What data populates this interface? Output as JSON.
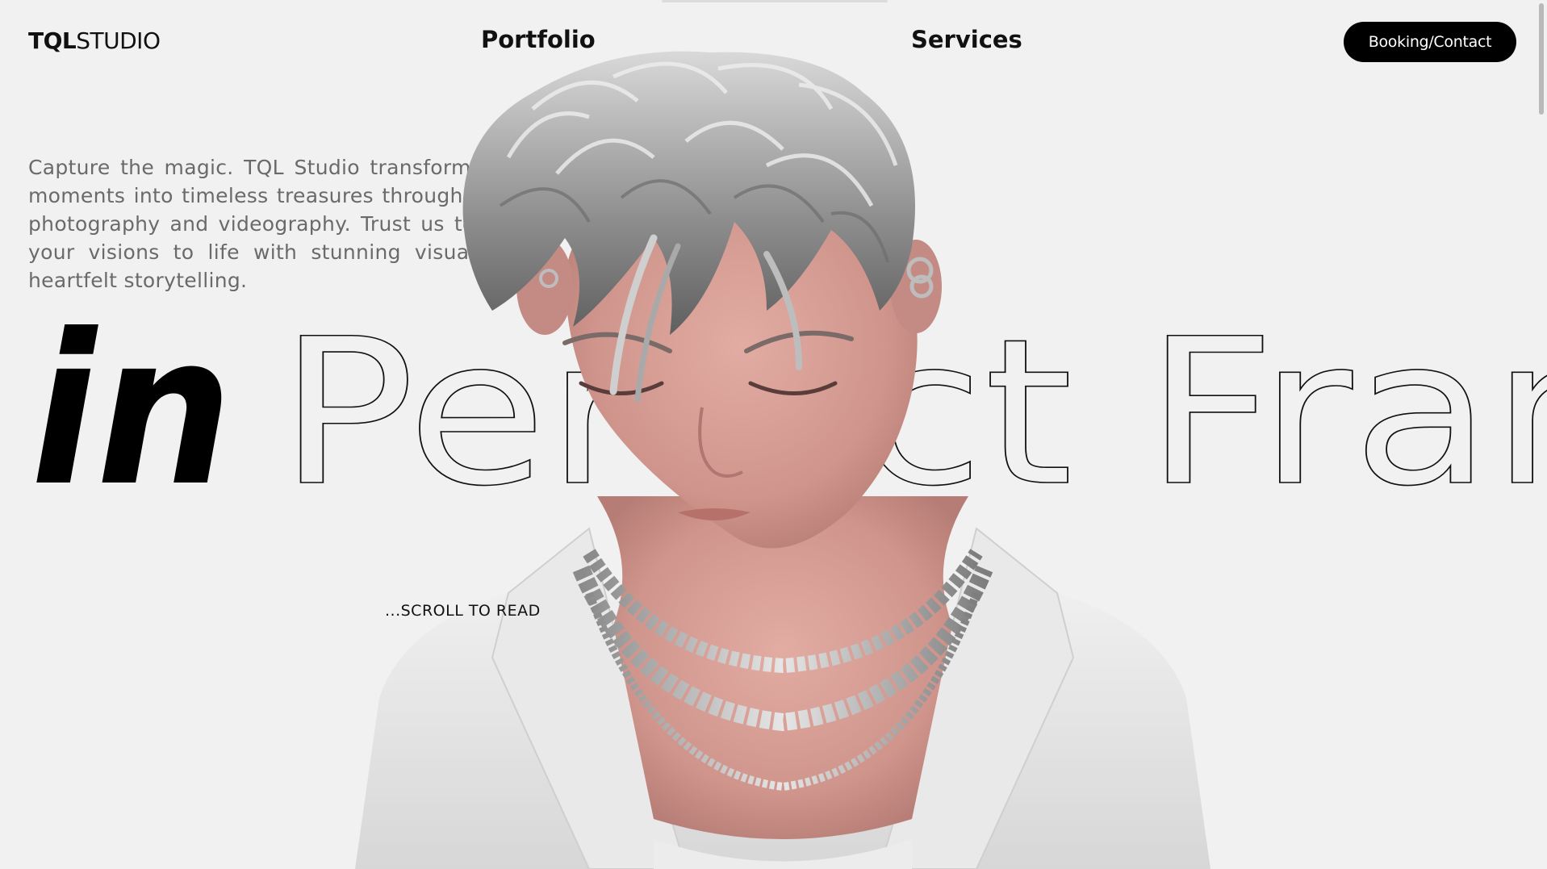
{
  "brand": {
    "bold": "TQL",
    "light": "STUDIO"
  },
  "nav": {
    "portfolio": "Portfolio",
    "services": "Services",
    "cta": "Booking/Contact"
  },
  "intro": {
    "text": "Capture the magic. TQL Studio transforms your moments into timeless treasures through expert photography and videography. Trust us to bring your visions to life with stunning visuals and heartfelt storytelling."
  },
  "headline": {
    "filled": "in",
    "outline": "Perfect Frame"
  },
  "scroll_hint": "...SCROLL TO READ",
  "colors": {
    "background": "#f1f1f1",
    "text": "#111111",
    "intro_text": "#6a6a6a",
    "cta_bg": "#000000",
    "cta_text": "#ffffff"
  },
  "icons": {
    "hero_figure": "3d-character-illustration"
  }
}
